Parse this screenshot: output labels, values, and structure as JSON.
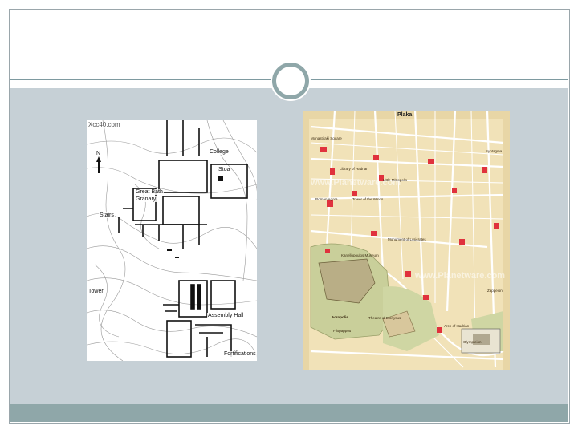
{
  "slide": {
    "accent_color": "#8fa7a9",
    "content_bg": "#c6d0d6"
  },
  "left_map": {
    "watermark": "Xcc40.com",
    "north": "N",
    "labels": {
      "college": "College",
      "stoa": "Stoa",
      "great_bath": "Great Bath",
      "granary": "Granary",
      "stairs": "Stairs",
      "tower": "Tower",
      "assembly_hall": "Assembly Hall",
      "fortifications": "Fortifications"
    }
  },
  "right_map": {
    "title": "Plaka",
    "watermark": "www.Planetware.com",
    "labels": {
      "roman_agora": "Roman Agora",
      "library_hadrian": "Library of Hadrian",
      "tower_winds": "Tower of the Winds",
      "acropolis": "Acropolis",
      "theatre_dionysus": "Theatre of Dionysus",
      "olympieion": "Olympieion",
      "arch_hadrian": "Arch of Hadrian",
      "kanellopoulos": "Kanellopoulos Museum",
      "monastiraki": "Monastiraki Square",
      "mitropolis": "Little Mitropolis",
      "lysicrates": "Monument of Lysicrates",
      "philopappou": "Filopappou",
      "syntagma": "Syntagma",
      "stadium": "Zappeion"
    }
  }
}
